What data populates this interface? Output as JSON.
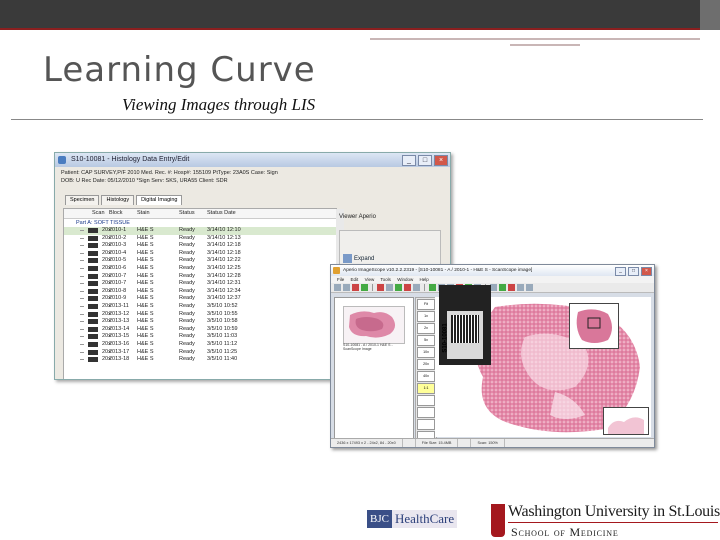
{
  "slide": {
    "title": "Learning Curve",
    "subtitle": "Viewing Images through LIS"
  },
  "lis_window": {
    "title": "S10-10081 - Histology Data Entry/Edit",
    "info_lines": [
      "Patient: CAP SURVEY,P/F 2010   Med. Rec. #:   Hosp#: 155109   PtType: 23A0S  Case: Sign",
      "DOB: U   Rec Date: 05/12/2010  *Sign   Serv: SKS, URA55  Client: SDR"
    ],
    "tabs": [
      "Specimen",
      "Histology",
      "Digital Imaging"
    ],
    "columns": [
      "Scan",
      "Block",
      "Stain",
      "Status",
      "Status Date"
    ],
    "part_label": "Part A: SOFT TISSUE",
    "rows": [
      {
        "scan": "20x",
        "block": "2010-1",
        "stain": "H&E S",
        "status": "Ready",
        "date": "3/14/10 12:10"
      },
      {
        "scan": "20x",
        "block": "2010-2",
        "stain": "H&E S",
        "status": "Ready",
        "date": "3/14/10 12:13"
      },
      {
        "scan": "20x",
        "block": "2010-3",
        "stain": "H&E S",
        "status": "Ready",
        "date": "3/14/10 12:18"
      },
      {
        "scan": "20x",
        "block": "2010-4",
        "stain": "H&E S",
        "status": "Ready",
        "date": "3/14/10 12:18"
      },
      {
        "scan": "20x",
        "block": "2010-5",
        "stain": "H&E S",
        "status": "Ready",
        "date": "3/14/10 12:22"
      },
      {
        "scan": "20x",
        "block": "2010-6",
        "stain": "H&E S",
        "status": "Ready",
        "date": "3/14/10 12:25"
      },
      {
        "scan": "20x",
        "block": "2010-7",
        "stain": "H&E S",
        "status": "Ready",
        "date": "3/14/10 12:28"
      },
      {
        "scan": "20x",
        "block": "2010-7",
        "stain": "H&E S",
        "status": "Ready",
        "date": "3/14/10 12:31"
      },
      {
        "scan": "20x",
        "block": "2010-8",
        "stain": "H&E S",
        "status": "Ready",
        "date": "3/14/10 12:34"
      },
      {
        "scan": "20x",
        "block": "2010-9",
        "stain": "H&E S",
        "status": "Ready",
        "date": "3/14/10 12:37"
      },
      {
        "scan": "20x",
        "block": "2013-11",
        "stain": "H&E S",
        "status": "Ready",
        "date": "3/5/10 10:52"
      },
      {
        "scan": "20x",
        "block": "2013-12",
        "stain": "H&E S",
        "status": "Ready",
        "date": "3/5/10 10:55"
      },
      {
        "scan": "20x",
        "block": "2013-13",
        "stain": "H&E S",
        "status": "Ready",
        "date": "3/5/10 10:58"
      },
      {
        "scan": "20x",
        "block": "2013-14",
        "stain": "H&E S",
        "status": "Ready",
        "date": "3/5/10 10:59"
      },
      {
        "scan": "20x",
        "block": "2013-15",
        "stain": "H&E S",
        "status": "Ready",
        "date": "3/5/10 11:03"
      },
      {
        "scan": "20x",
        "block": "2013-16",
        "stain": "H&E S",
        "status": "Ready",
        "date": "3/5/10 11:12"
      },
      {
        "scan": "20x",
        "block": "2013-17",
        "stain": "H&E S",
        "status": "Ready",
        "date": "3/5/10 11:25"
      },
      {
        "scan": "20x",
        "block": "2013-18",
        "stain": "H&E S",
        "status": "Ready",
        "date": "3/5/10 11:40"
      }
    ],
    "viewer_label": "Viewer Aperio",
    "expand_label": "Expand"
  },
  "imagescope": {
    "title": "Aperio ImageScope v10.2.2.2319 - [S10-10081 - A / 2010-1 - H&E S - ScanScope image]",
    "menu": [
      "File",
      "Edit",
      "View",
      "Tools",
      "Window",
      "Help"
    ],
    "thumb_caption": "S10-10081 - A / 2010-1 H&E S - ScanScope Image",
    "zoom_levels": [
      "Fit",
      "1x",
      "2x",
      "5x",
      "10x",
      "20x",
      "40x",
      "1:1",
      "",
      "",
      "",
      "",
      ""
    ],
    "slide_label": "S10-10081",
    "status_items": [
      "2436 x 17493 x 2 - 24x2, 84 - 20x0",
      "",
      "File Size: 15.4MB",
      "",
      "Scan: 150%"
    ]
  },
  "logos": {
    "bjc_short": "BJC",
    "bjc_rest": "HealthCare",
    "wu_name": "Washington University in St.Louis",
    "wu_school": "School of Medicine"
  },
  "colors": {
    "top_bar": "#3a3a3a",
    "accent_red": "#8b1f1f",
    "tissue_pink": "#d9779a",
    "selected_row": "#d9e9cf"
  }
}
